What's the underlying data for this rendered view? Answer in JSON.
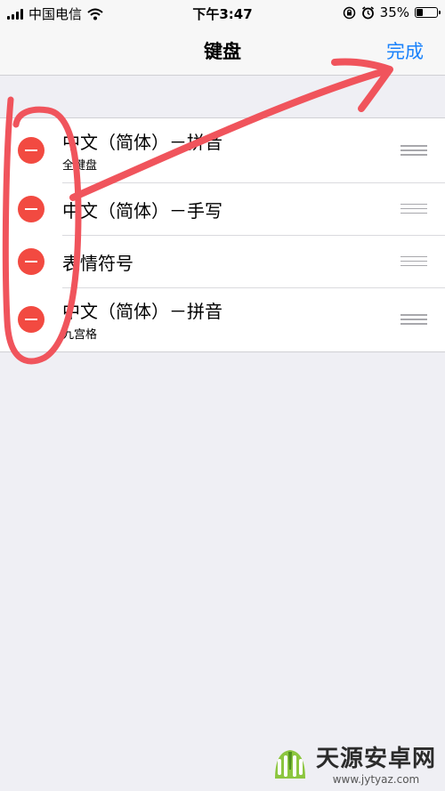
{
  "status_bar": {
    "carrier": "中国电信",
    "time": "下午3:47",
    "battery_percent": "35%",
    "battery_level": 0.35,
    "icons": [
      "signal-icon",
      "wifi-icon",
      "orientation-lock-icon",
      "alarm-icon",
      "battery-icon"
    ]
  },
  "nav": {
    "title": "键盘",
    "done_label": "完成"
  },
  "keyboards": [
    {
      "title": "中文（简体）－拼音",
      "subtitle": "全键盘"
    },
    {
      "title": "中文（简体）－手写",
      "subtitle": ""
    },
    {
      "title": "表情符号",
      "subtitle": ""
    },
    {
      "title": "中文（简体）－拼音",
      "subtitle": "九宫格"
    }
  ],
  "annotation_color": "#f0545c",
  "watermark": {
    "name": "天源安卓网",
    "url": "www.jytyaz.com"
  }
}
